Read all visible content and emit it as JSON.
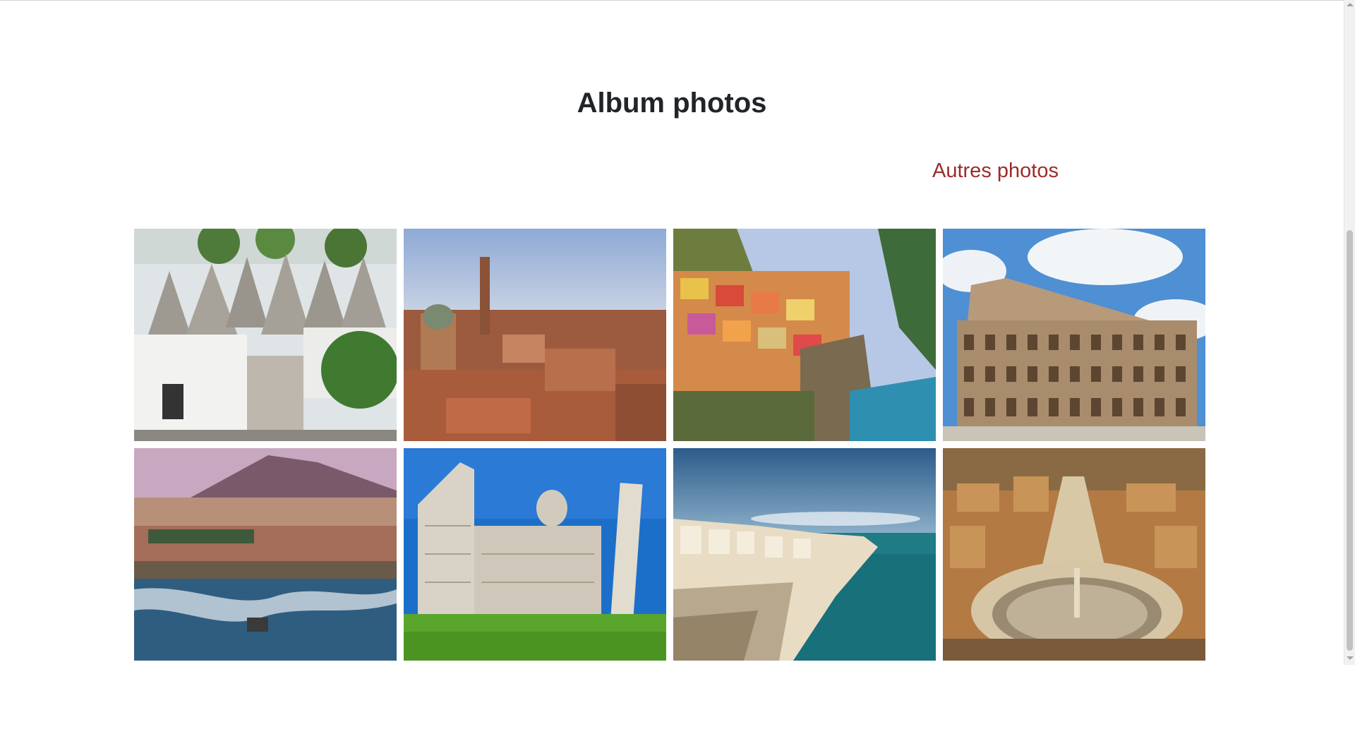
{
  "page": {
    "title": "Album photos",
    "other_photos_link": "Autres photos"
  },
  "colors": {
    "title": "#212529",
    "link": "#9b2c2c"
  },
  "gallery": {
    "photos": [
      {
        "subject": "trulli-houses-village"
      },
      {
        "subject": "bologna-rooftops-tower"
      },
      {
        "subject": "cinque-terre-cliff-village"
      },
      {
        "subject": "colosseum-rome"
      },
      {
        "subject": "naples-vesuvius-coast"
      },
      {
        "subject": "pisa-cathedral-leaning-tower"
      },
      {
        "subject": "cliffside-seaside-town"
      },
      {
        "subject": "st-peters-square-aerial"
      }
    ]
  }
}
